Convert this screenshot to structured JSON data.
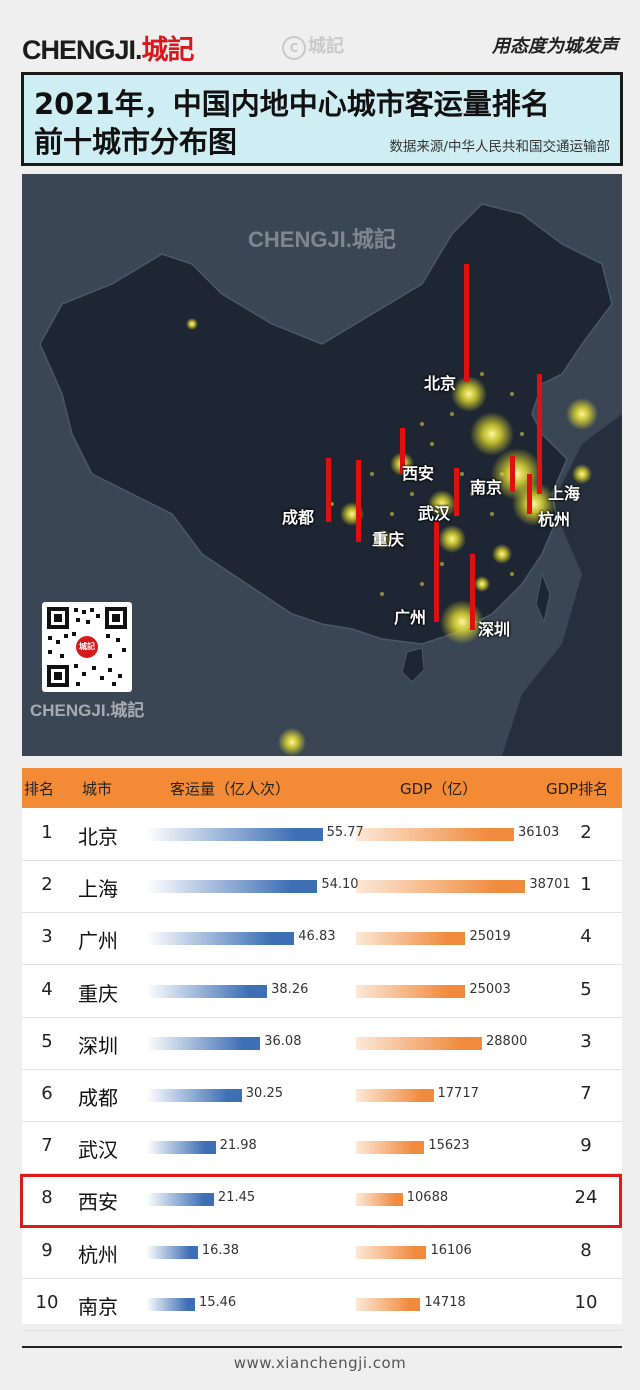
{
  "header": {
    "logo_main": "CHENGJI.",
    "logo_cn": "城記",
    "watermark": "城記",
    "slogan": "用态度为城发声"
  },
  "title": {
    "line1": "2021年，中国内地中心城市客运量排名",
    "line2": "前十城市分布图",
    "source": "数据来源/中华人民共和国交通运输部"
  },
  "map": {
    "watermark_top": "CHENGJI.城記",
    "watermark_bottom": "CHENGJI.城記",
    "qr_center": "城記",
    "labels": [
      "北京",
      "西安",
      "南京",
      "上海",
      "成都",
      "武汉",
      "杭州",
      "重庆",
      "广州",
      "深圳"
    ]
  },
  "colors": {
    "header_band": "#f28a36",
    "passenger_bar": "#3d6fb5",
    "gdp_bar": "#f08a3c",
    "highlight": "#e01a1a",
    "title_bg": "#cfeef3",
    "map_bar": "#e01010"
  },
  "chart_data": {
    "type": "table",
    "columns": [
      "排名",
      "城市",
      "客运量（亿人次）",
      "GDP（亿）",
      "GDP排名"
    ],
    "rows": [
      {
        "rank": "1",
        "city": "北京",
        "passengers": 55.77,
        "passengers_label": "55.77",
        "gdp": 36103,
        "gdp_label": "36103",
        "gdp_rank": "2"
      },
      {
        "rank": "2",
        "city": "上海",
        "passengers": 54.1,
        "passengers_label": "54.10",
        "gdp": 38701,
        "gdp_label": "38701",
        "gdp_rank": "1"
      },
      {
        "rank": "3",
        "city": "广州",
        "passengers": 46.83,
        "passengers_label": "46.83",
        "gdp": 25019,
        "gdp_label": "25019",
        "gdp_rank": "4"
      },
      {
        "rank": "4",
        "city": "重庆",
        "passengers": 38.26,
        "passengers_label": "38.26",
        "gdp": 25003,
        "gdp_label": "25003",
        "gdp_rank": "5"
      },
      {
        "rank": "5",
        "city": "深圳",
        "passengers": 36.08,
        "passengers_label": "36.08",
        "gdp": 28800,
        "gdp_label": "28800",
        "gdp_rank": "3"
      },
      {
        "rank": "6",
        "city": "成都",
        "passengers": 30.25,
        "passengers_label": "30.25",
        "gdp": 17717,
        "gdp_label": "17717",
        "gdp_rank": "7"
      },
      {
        "rank": "7",
        "city": "武汉",
        "passengers": 21.98,
        "passengers_label": "21.98",
        "gdp": 15623,
        "gdp_label": "15623",
        "gdp_rank": "9"
      },
      {
        "rank": "8",
        "city": "西安",
        "passengers": 21.45,
        "passengers_label": "21.45",
        "gdp": 10688,
        "gdp_label": "10688",
        "gdp_rank": "24",
        "highlight": true
      },
      {
        "rank": "9",
        "city": "杭州",
        "passengers": 16.38,
        "passengers_label": "16.38",
        "gdp": 16106,
        "gdp_label": "16106",
        "gdp_rank": "8"
      },
      {
        "rank": "10",
        "city": "南京",
        "passengers": 15.46,
        "passengers_label": "15.46",
        "gdp": 14718,
        "gdp_label": "14718",
        "gdp_rank": "10"
      }
    ]
  },
  "footer": {
    "website": "www.xianchengji.com"
  }
}
